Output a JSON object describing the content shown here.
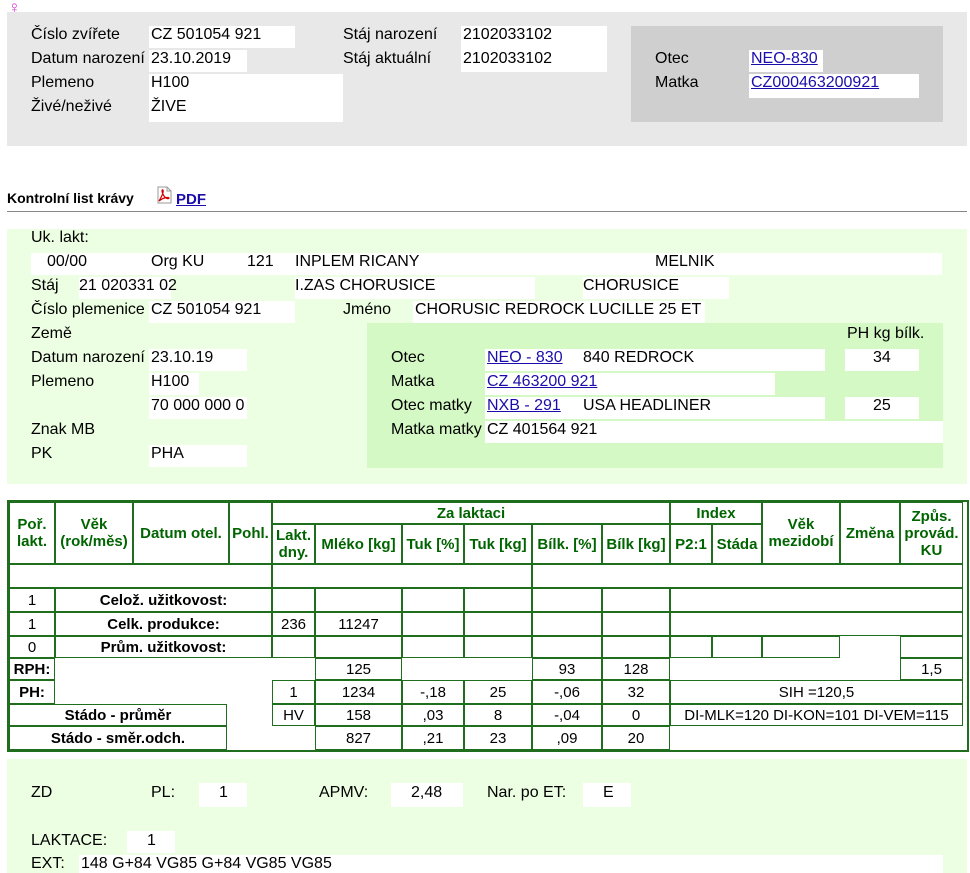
{
  "symbol": "♀",
  "animal": {
    "cislo_label": "Číslo zvířete",
    "cislo": "CZ 501054 921",
    "datum_label": "Datum narození",
    "datum": "23.10.2019",
    "plemeno_label": "Plemeno",
    "plemeno": "H100",
    "zive_label": "Živé/neživé",
    "zive": "ŽIVE",
    "staj_nar_label": "Stáj narození",
    "staj_nar": "2102033102",
    "staj_akt_label": "Stáj aktuální",
    "staj_akt": "2102033102",
    "otec_label": "Otec",
    "otec": "NEO-830",
    "matka_label": "Matka",
    "matka": "CZ000463200921"
  },
  "kl": {
    "title": "Kontrolní list krávy",
    "pdf_label": "PDF",
    "uk_label": "Uk. lakt:",
    "uk_value": "00/00",
    "org_label": "Org KU",
    "org_num": "121",
    "org_name": "INPLEM RICANY",
    "org_city": "MELNIK",
    "staj_label": "Stáj",
    "staj_value": "21 020331 02",
    "staj_name": "I.ZAS CHORUSICE",
    "staj_city": "CHORUSICE",
    "plemenice_label": "Číslo plemenice",
    "plemenice": "CZ 501054 921",
    "jmeno_label": "Jméno",
    "jmeno": "CHORUSIC REDROCK LUCILLE 25 ET",
    "zeme_label": "Země",
    "ph_label": "PH kg bílk.",
    "datum_label": "Datum narození",
    "datum": "23.10.19",
    "plemeno_label": "Plemeno",
    "plemeno": "H100",
    "plemeno_code": "70 000 000 0",
    "znak_label": "Znak MB",
    "pk_label": "PK",
    "pk": "PHA",
    "otec_label": "Otec",
    "otec_link": "NEO - 830",
    "otec_name": "840 REDROCK",
    "otec_ph": "34",
    "matka_label": "Matka",
    "matka_link": "CZ 463200 921",
    "otec_matky_label": "Otec matky",
    "otec_matky_link": "NXB - 291",
    "otec_matky_name": "USA HEADLINER",
    "otec_matky_ph": "25",
    "matka_matky_label": "Matka matky",
    "matka_matky": "CZ 401564 921"
  },
  "table": {
    "h_por": "Poř. lakt.",
    "h_vek": "Věk (rok/měs)",
    "h_datum": "Datum otel.",
    "h_pohl": "Pohl.",
    "h_za": "Za laktaci",
    "h_index": "Index",
    "h_vekm": "Věk mezidobí",
    "h_zmena": "Změna",
    "h_zpus": "Způs. provád. KU",
    "h_lakt": "Lakt. dny.",
    "h_mleko": "Mléko [kg]",
    "h_tukp": "Tuk [%]",
    "h_tukk": "Tuk [kg]",
    "h_bilp": "Bílk. [%]",
    "h_bilk": "Bílk [kg]",
    "h_p21": "P2:1",
    "h_stada": "Stáda",
    "r1_num": "1",
    "r1_label": "Celož. užitkovost:",
    "r2_num": "1",
    "r2_label": "Celk. produkce:",
    "r2_dny": "236",
    "r2_mleko": "11247",
    "r3_num": "0",
    "r3_label": "Prům. užitkovost:",
    "rph_label": "RPH:",
    "rph_mleko": "125",
    "rph_bilp": "93",
    "rph_bilk": "128",
    "rph_zpus": "1,5",
    "ph_label": "PH:",
    "ph_dny": "1",
    "ph_mleko": "1234",
    "ph_tukp": "-,18",
    "ph_tukk": "25",
    "ph_bilp": "-,06",
    "ph_bilk": "32",
    "sih": "SIH =120,5",
    "sp_label": "Stádo - průměr",
    "sp_dny": "HV",
    "sp_mleko": "158",
    "sp_tukp": ",03",
    "sp_tukk": "8",
    "sp_bilp": "-,04",
    "sp_bilk": "0",
    "di": "DI-MLK=120 DI-KON=101 DI-VEM=115",
    "so_label": "Stádo - směr.odch.",
    "so_mleko": "827",
    "so_tukp": ",21",
    "so_tukk": "23",
    "so_bilp": ",09",
    "so_bilk": "20"
  },
  "bottom": {
    "zd_label": "ZD",
    "pl_label": "PL:",
    "pl": "1",
    "apmv_label": "APMV:",
    "apmv": "2,48",
    "nar_label": "Nar. po ET:",
    "nar": "E",
    "laktace_label": "LAKTACE:",
    "laktace": "1",
    "ext_label": "EXT:",
    "ext": "148 G+84 VG85 G+84 VG85 VG85"
  }
}
